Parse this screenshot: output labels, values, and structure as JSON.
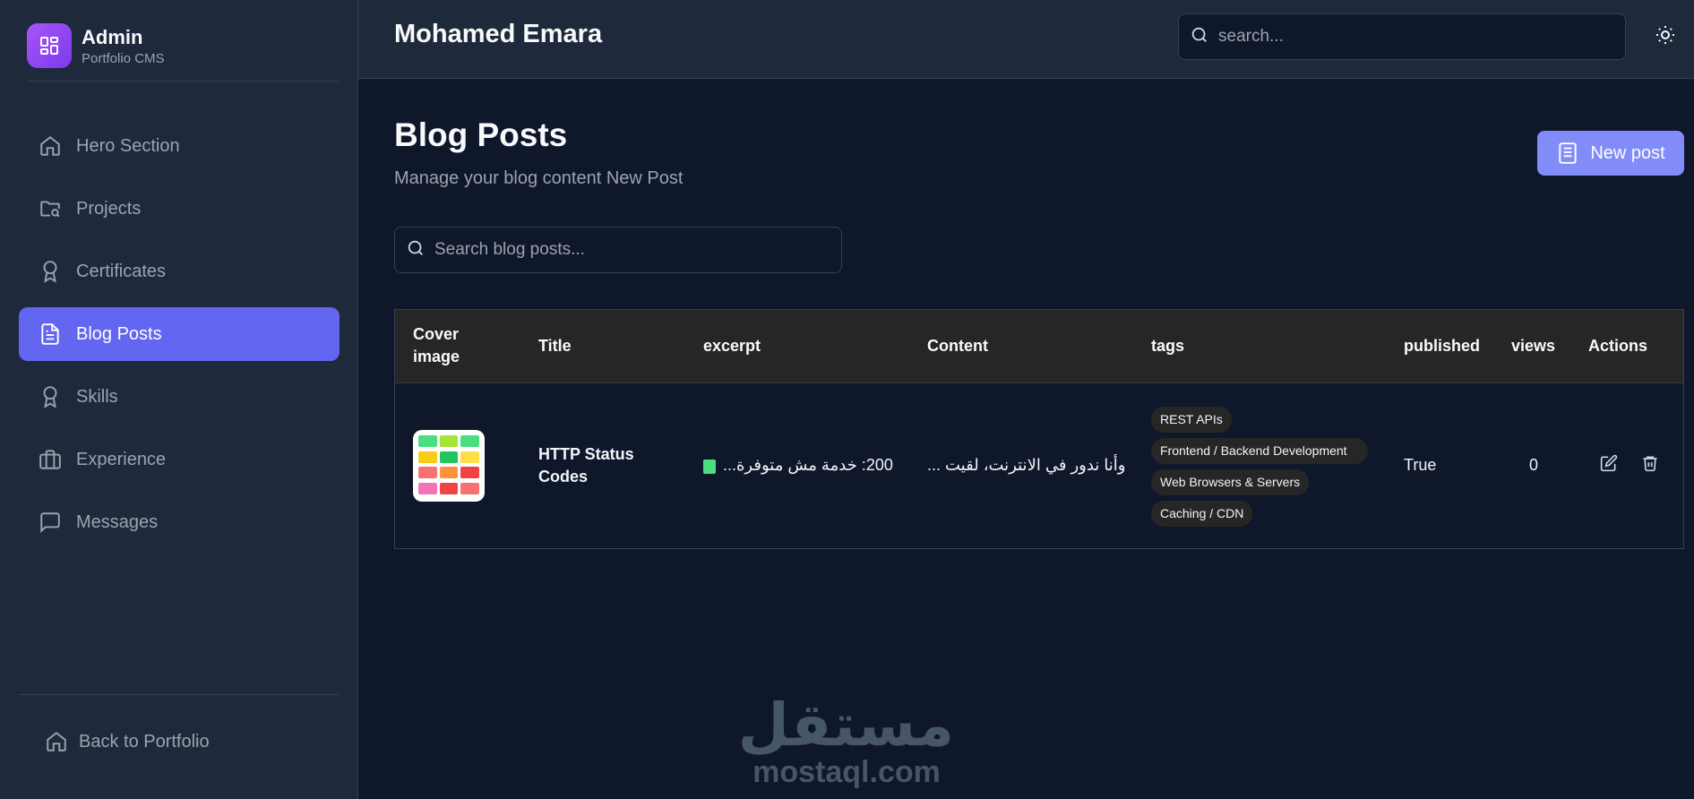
{
  "brand": {
    "title": "Admin",
    "subtitle": "Portfolio CMS"
  },
  "sidebar": {
    "items": [
      {
        "label": "Hero Section",
        "icon": "home-icon",
        "active": false
      },
      {
        "label": "Projects",
        "icon": "folder-icon",
        "active": false
      },
      {
        "label": "Certificates",
        "icon": "award-icon",
        "active": false
      },
      {
        "label": "Blog Posts",
        "icon": "document-icon",
        "active": true
      },
      {
        "label": "Skills",
        "icon": "award-icon",
        "active": false
      },
      {
        "label": "Experience",
        "icon": "briefcase-icon",
        "active": false
      },
      {
        "label": "Messages",
        "icon": "message-icon",
        "active": false
      }
    ],
    "back_label": "Back to Portfolio"
  },
  "header": {
    "user_name": "Mohamed Emara",
    "search_placeholder": "search..."
  },
  "main": {
    "title": "Blog Posts",
    "subtitle": "Manage your blog content New Post",
    "new_post_label": "New post",
    "search_placeholder": "Search blog posts..."
  },
  "table": {
    "headers": [
      "Cover image",
      "Title",
      "excerpt",
      "Content",
      "tags",
      "published",
      "views",
      "Actions"
    ],
    "rows": [
      {
        "title": "HTTP Status Codes",
        "excerpt": "200: خدمة مش متوفرة...",
        "content": "وأنا ندور في الانترنت، لقيت ...",
        "tags": [
          "REST APIs",
          "Frontend / Backend Development",
          "Web Browsers & Servers",
          "Caching / CDN"
        ],
        "published": "True",
        "views": "0"
      }
    ]
  },
  "watermark": {
    "logo": "مستقل",
    "url": "mostaql.com"
  },
  "colors": {
    "accent": "#6366f1",
    "button": "#818cf8",
    "background": "#0f172a",
    "panel": "#1e293b"
  }
}
